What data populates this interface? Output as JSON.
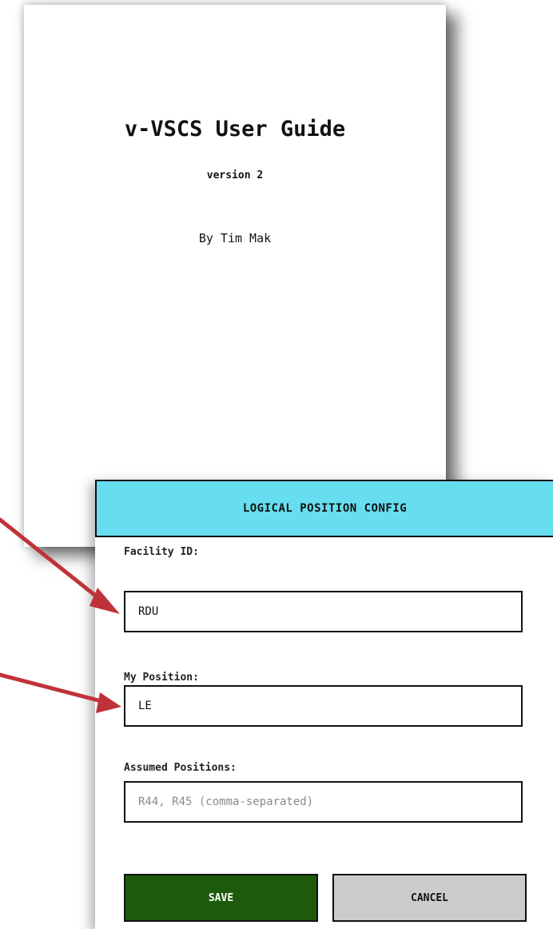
{
  "cover": {
    "title": "v-VSCS User Guide",
    "version": "version 2",
    "author": "By Tim Mak"
  },
  "dialog": {
    "title": "LOGICAL POSITION CONFIG",
    "facility_label": "Facility ID:",
    "facility_value": "RDU",
    "position_label": "My Position:",
    "position_value": "LE",
    "assumed_label": "Assumed Positions:",
    "assumed_value": "",
    "assumed_placeholder": "R44, R45 (comma-separated)",
    "save_label": "SAVE",
    "cancel_label": "CANCEL"
  },
  "colors": {
    "header_bg": "#67def0",
    "save_bg": "#1d5a0c",
    "cancel_bg": "#cccccc",
    "arrow": "#c0323a"
  }
}
